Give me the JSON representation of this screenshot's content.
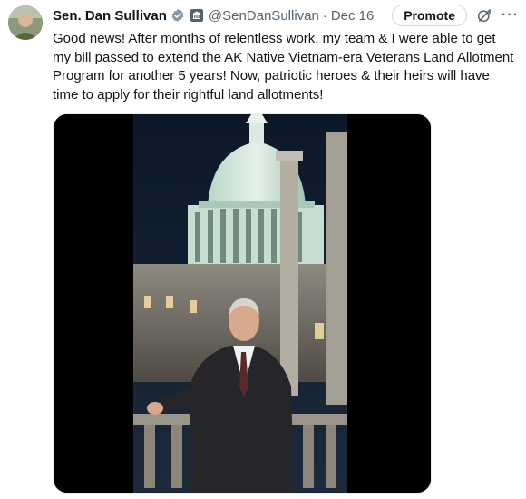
{
  "tweet": {
    "author_name": "Sen. Dan Sullivan",
    "handle": "@SenDanSullivan",
    "separator": "·",
    "date": "Dec 16",
    "promote_label": "Promote",
    "more_label": "···",
    "text": "Good news! After months of relentless work, my team & I were able to get my bill passed to extend the AK Native Vietnam-era Veterans Land Allotment Program for another 5 years! Now, patriotic heroes & their heirs will have time to apply for their rightful land allotments!"
  },
  "icons": {
    "verified": "verified-badge-icon",
    "gov": "government-affiliation-icon",
    "grok": "grok-icon",
    "more": "more-icon"
  },
  "colors": {
    "verified_gray": "#829aab",
    "secondary_text": "#536471",
    "border": "#cfd9de"
  }
}
